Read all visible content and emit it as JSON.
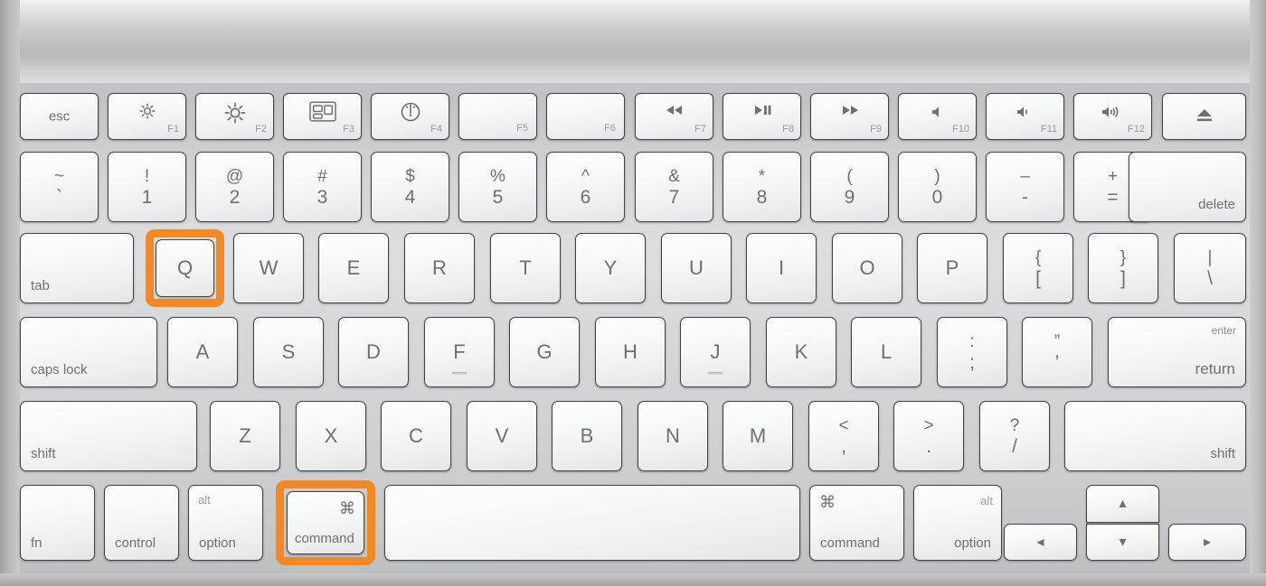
{
  "device": {
    "name": "Apple Wireless Keyboard",
    "layout": "US English",
    "body_color": "#c8cbcd",
    "key_face_color": "#f7f8f8",
    "legend_color": "#6d7073",
    "highlight_color": "#F5881F"
  },
  "highlights": [
    {
      "key": "Q",
      "shortcut_role": "letter"
    },
    {
      "key": "command",
      "shortcut_role": "modifier"
    }
  ],
  "shortcut": {
    "combo": "command + Q",
    "keys": [
      "command",
      "Q"
    ]
  },
  "rows": {
    "function_row": [
      {
        "name": "escape",
        "label": "esc",
        "fn": "",
        "icon": ""
      },
      {
        "name": "brightness-down",
        "label": "",
        "fn": "F1",
        "icon": "brightness-down-icon"
      },
      {
        "name": "brightness-up",
        "label": "",
        "fn": "F2",
        "icon": "brightness-up-icon"
      },
      {
        "name": "mission-control",
        "label": "",
        "fn": "F3",
        "icon": "mission-control-icon"
      },
      {
        "name": "dashboard",
        "label": "",
        "fn": "F4",
        "icon": "dashboard-gauge-icon"
      },
      {
        "name": "f5",
        "label": "",
        "fn": "F5",
        "icon": ""
      },
      {
        "name": "f6",
        "label": "",
        "fn": "F6",
        "icon": ""
      },
      {
        "name": "rewind",
        "label": "",
        "fn": "F7",
        "icon": "rewind-icon"
      },
      {
        "name": "play-pause",
        "label": "",
        "fn": "F8",
        "icon": "play-pause-icon"
      },
      {
        "name": "fast-forward",
        "label": "",
        "fn": "F9",
        "icon": "fast-forward-icon"
      },
      {
        "name": "mute",
        "label": "",
        "fn": "F10",
        "icon": "volume-mute-icon"
      },
      {
        "name": "volume-down",
        "label": "",
        "fn": "F11",
        "icon": "volume-down-icon"
      },
      {
        "name": "volume-up",
        "label": "",
        "fn": "F12",
        "icon": "volume-up-icon"
      },
      {
        "name": "eject",
        "label": "",
        "fn": "",
        "icon": "eject-icon"
      }
    ],
    "number_row": [
      {
        "name": "grave",
        "top": "~",
        "bottom": "`"
      },
      {
        "name": "1",
        "top": "!",
        "bottom": "1"
      },
      {
        "name": "2",
        "top": "@",
        "bottom": "2"
      },
      {
        "name": "3",
        "top": "#",
        "bottom": "3"
      },
      {
        "name": "4",
        "top": "$",
        "bottom": "4"
      },
      {
        "name": "5",
        "top": "%",
        "bottom": "5"
      },
      {
        "name": "6",
        "top": "^",
        "bottom": "6"
      },
      {
        "name": "7",
        "top": "&",
        "bottom": "7"
      },
      {
        "name": "8",
        "top": "*",
        "bottom": "8"
      },
      {
        "name": "9",
        "top": "(",
        "bottom": "9"
      },
      {
        "name": "0",
        "top": ")",
        "bottom": "0"
      },
      {
        "name": "minus",
        "top": "–",
        "bottom": "-"
      },
      {
        "name": "equal",
        "top": "+",
        "bottom": "="
      },
      {
        "name": "delete",
        "label": "delete"
      }
    ],
    "top_letter_row": [
      {
        "name": "tab",
        "label": "tab"
      },
      {
        "name": "q",
        "label": "Q"
      },
      {
        "name": "w",
        "label": "W"
      },
      {
        "name": "e",
        "label": "E"
      },
      {
        "name": "r",
        "label": "R"
      },
      {
        "name": "t",
        "label": "T"
      },
      {
        "name": "y",
        "label": "Y"
      },
      {
        "name": "u",
        "label": "U"
      },
      {
        "name": "i",
        "label": "I"
      },
      {
        "name": "o",
        "label": "O"
      },
      {
        "name": "p",
        "label": "P"
      },
      {
        "name": "bracket-left",
        "top": "{",
        "bottom": "["
      },
      {
        "name": "bracket-right",
        "top": "}",
        "bottom": "]"
      },
      {
        "name": "backslash",
        "top": "|",
        "bottom": "\\"
      }
    ],
    "home_row": [
      {
        "name": "caps-lock",
        "label": "caps lock"
      },
      {
        "name": "a",
        "label": "A"
      },
      {
        "name": "s",
        "label": "S"
      },
      {
        "name": "d",
        "label": "D"
      },
      {
        "name": "f",
        "label": "F",
        "bump": true
      },
      {
        "name": "g",
        "label": "G"
      },
      {
        "name": "h",
        "label": "H"
      },
      {
        "name": "j",
        "label": "J",
        "bump": true
      },
      {
        "name": "k",
        "label": "K"
      },
      {
        "name": "l",
        "label": "L"
      },
      {
        "name": "semicolon",
        "top": ":",
        "bottom": ";"
      },
      {
        "name": "quote",
        "top": "”",
        "bottom": "’"
      },
      {
        "name": "return",
        "label": "return",
        "secondary": "enter"
      }
    ],
    "bottom_letter_row": [
      {
        "name": "shift-left",
        "label": "shift"
      },
      {
        "name": "z",
        "label": "Z"
      },
      {
        "name": "x",
        "label": "X"
      },
      {
        "name": "c",
        "label": "C"
      },
      {
        "name": "v",
        "label": "V"
      },
      {
        "name": "b",
        "label": "B"
      },
      {
        "name": "n",
        "label": "N"
      },
      {
        "name": "m",
        "label": "M"
      },
      {
        "name": "comma",
        "top": "<",
        "bottom": ","
      },
      {
        "name": "period",
        "top": ">",
        "bottom": "."
      },
      {
        "name": "slash",
        "top": "?",
        "bottom": "/"
      },
      {
        "name": "shift-right",
        "label": "shift"
      }
    ],
    "modifier_row": [
      {
        "name": "fn",
        "label": "fn"
      },
      {
        "name": "control",
        "label": "control"
      },
      {
        "name": "option-left",
        "label": "option",
        "secondary": "alt"
      },
      {
        "name": "command-left",
        "label": "command",
        "symbol": "⌘"
      },
      {
        "name": "space",
        "label": ""
      },
      {
        "name": "command-right",
        "label": "command",
        "symbol": "⌘"
      },
      {
        "name": "option-right",
        "label": "option",
        "secondary": "alt"
      },
      {
        "name": "arrow-left",
        "label": "◂"
      },
      {
        "name": "arrow-up",
        "label": "▴"
      },
      {
        "name": "arrow-down",
        "label": "▾"
      },
      {
        "name": "arrow-right",
        "label": "▸"
      }
    ]
  }
}
